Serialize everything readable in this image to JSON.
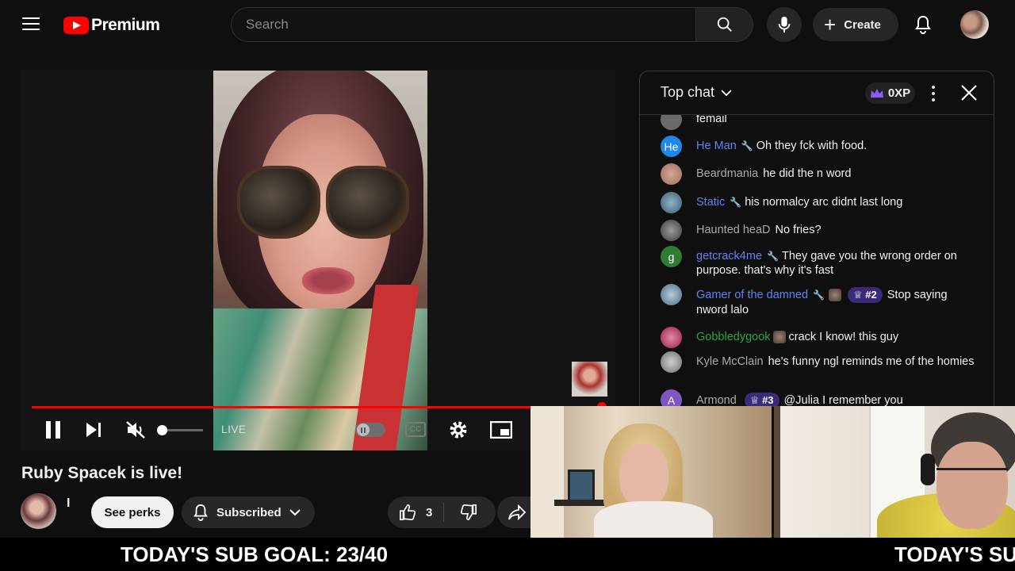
{
  "header": {
    "logo_text": "Premium",
    "search_placeholder": "Search",
    "create_label": "Create",
    "brand_color": "#ff0000"
  },
  "player": {
    "status_label": "LIVE",
    "cc_label": "CC",
    "progress_color": "#ff0000",
    "volume_fraction": 0.0
  },
  "video": {
    "title": "Ruby Spacek is live!",
    "channel_name": "I",
    "perks_label": "See perks",
    "subscribed_label": "Subscribed",
    "like_count": "3"
  },
  "chat": {
    "header_title": "Top chat",
    "xp_label": "0XP",
    "messages": [
      {
        "author": "",
        "text": "femail",
        "avatar_letter": "",
        "avatar_color": "#6a6a6a"
      },
      {
        "author": "He Man",
        "text": "Oh they fck with food.",
        "avatar_letter": "He",
        "avatar_color": "#1e88e5",
        "author_color": "#5e84f1"
      },
      {
        "author": "Beardmania",
        "text": "he did the n word",
        "avatar_letter": "",
        "avatar_color": "#9e6b5c",
        "author_color": "#aaaaaa"
      },
      {
        "author": "Static",
        "text": "his normalcy arc didnt last long",
        "avatar_letter": "",
        "avatar_color": "#4b6f86",
        "author_color": "#5e84f1"
      },
      {
        "author": "Haunted heaD",
        "text": "No fries?",
        "avatar_letter": "",
        "avatar_color": "#5a5a5a",
        "author_color": "#aaaaaa"
      },
      {
        "author": "getcrack4me",
        "text": "They gave you the wrong order on purpose. that's why it's fast",
        "avatar_letter": "g",
        "avatar_color": "#2e7d32",
        "author_color": "#5e84f1"
      },
      {
        "author": "Gamer of the damned",
        "rank": "#2",
        "text": "Stop saying nword lalo",
        "avatar_letter": "",
        "avatar_color": "#567a9b",
        "author_color": "#5e84f1"
      },
      {
        "author": "Gobbledygook",
        "text": "crack I know! this guy",
        "avatar_letter": "",
        "avatar_color": "#b2334e",
        "author_color": "#2ba640"
      },
      {
        "author": "Kyle McClain",
        "text": "he's funny ngl reminds me of the homies",
        "avatar_letter": "",
        "avatar_color": "#8d8d8d",
        "author_color": "#aaaaaa"
      },
      {
        "author": "Armond",
        "rank": "#3",
        "text": "@Julia I remember you",
        "avatar_letter": "A",
        "avatar_color": "#7e57c2",
        "author_color": "#aaaaaa"
      }
    ]
  },
  "ticker": {
    "text_1": "TODAY'S SUB GOAL: 23/40",
    "text_2": "TODAY'S SU"
  }
}
